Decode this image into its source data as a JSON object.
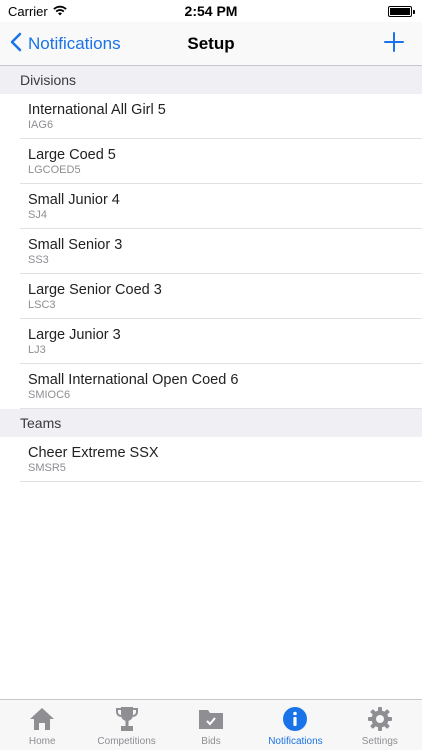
{
  "status_bar": {
    "carrier": "Carrier",
    "time": "2:54 PM"
  },
  "nav": {
    "back_label": "Notifications",
    "title": "Setup"
  },
  "sections": {
    "divisions": {
      "header": "Divisions",
      "items": [
        {
          "title": "International All Girl 5",
          "subtitle": "IAG6"
        },
        {
          "title": "Large Coed 5",
          "subtitle": "LGCOED5"
        },
        {
          "title": "Small Junior 4",
          "subtitle": "SJ4"
        },
        {
          "title": "Small Senior 3",
          "subtitle": "SS3"
        },
        {
          "title": "Large Senior Coed 3",
          "subtitle": "LSC3"
        },
        {
          "title": "Large Junior 3",
          "subtitle": "LJ3"
        },
        {
          "title": "Small International Open Coed 6",
          "subtitle": "SMIOC6"
        }
      ]
    },
    "teams": {
      "header": "Teams",
      "items": [
        {
          "title": "Cheer Extreme SSX",
          "subtitle": "SMSR5"
        }
      ]
    }
  },
  "tabs": [
    {
      "label": "Home",
      "icon": "home-icon"
    },
    {
      "label": "Competitions",
      "icon": "trophy-icon"
    },
    {
      "label": "Bids",
      "icon": "folder-check-icon"
    },
    {
      "label": "Notifications",
      "icon": "info-icon",
      "active": true
    },
    {
      "label": "Settings",
      "icon": "gear-icon"
    }
  ],
  "colors": {
    "accent": "#1a73e8",
    "inactive": "#8e8e93",
    "section_bg": "#efeff4"
  }
}
